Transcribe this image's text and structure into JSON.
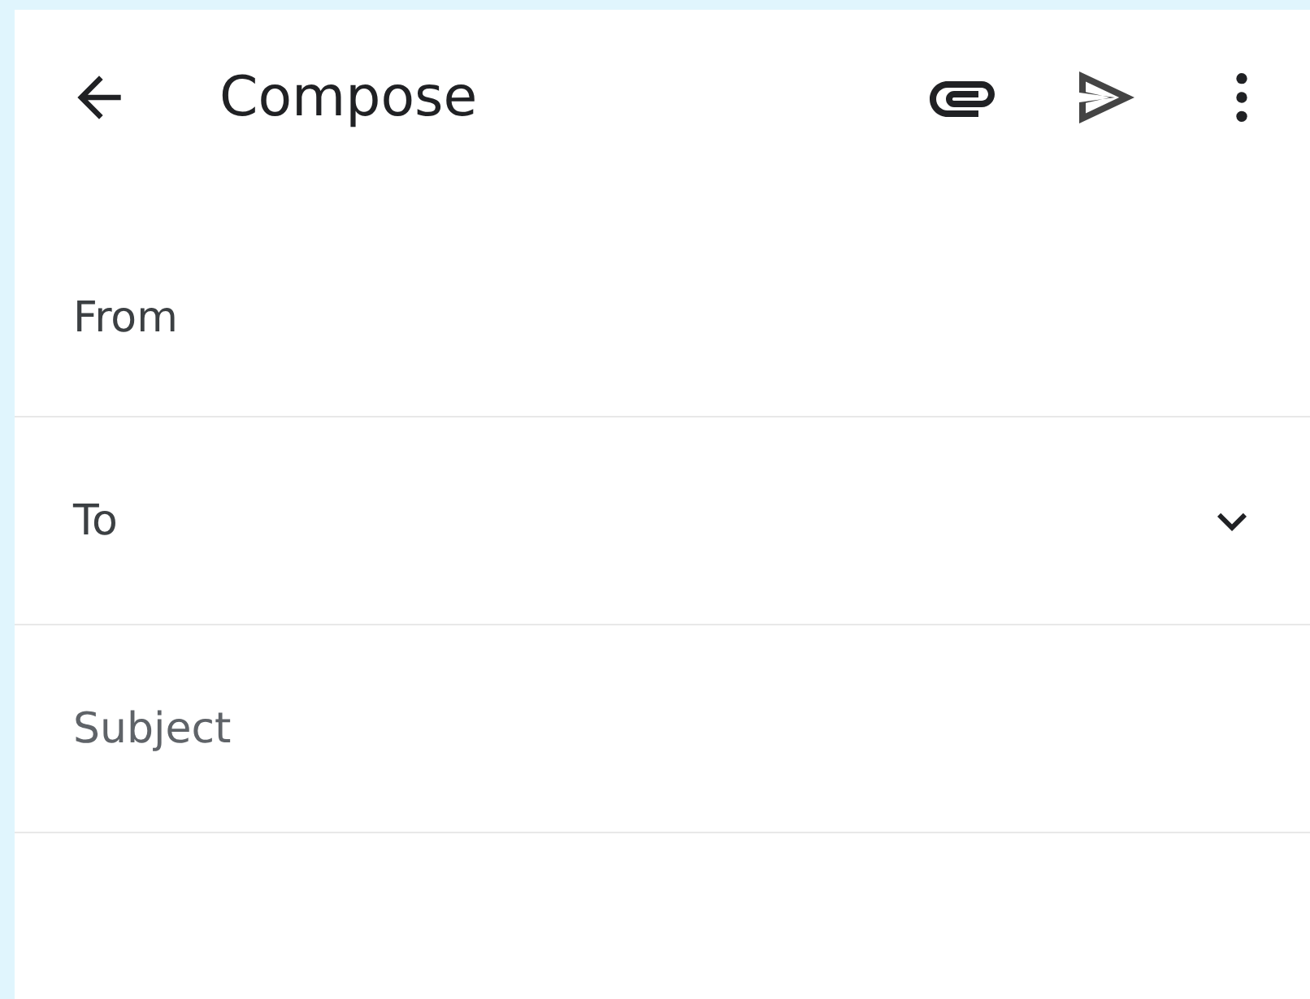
{
  "toolbar": {
    "title": "Compose"
  },
  "fields": [
    {
      "kind": "label",
      "label": "From"
    },
    {
      "kind": "dropdown",
      "label": "To"
    },
    {
      "kind": "input",
      "placeholder": "Subject"
    }
  ]
}
